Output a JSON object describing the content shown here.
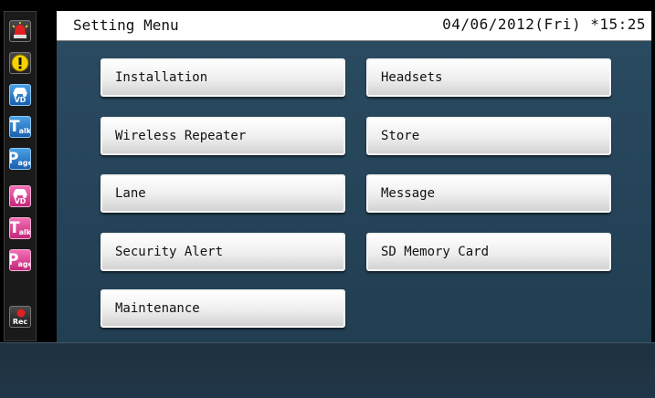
{
  "header": {
    "title": "Setting Menu",
    "datetime": "04/06/2012(Fri) *15:25"
  },
  "sidebar": {
    "icons": [
      {
        "name": "alarm-lamp-icon"
      },
      {
        "name": "warning-icon",
        "glyph": "!"
      },
      {
        "name": "vehicle-detector-icon",
        "label": "VD",
        "color": "blue"
      },
      {
        "name": "talk-icon",
        "big": "T",
        "small": "alk",
        "color": "blue"
      },
      {
        "name": "page-icon",
        "big": "P",
        "small": "age",
        "color": "blue"
      },
      {
        "name": "vehicle-detector-icon",
        "label": "VD",
        "color": "pink"
      },
      {
        "name": "talk-icon",
        "big": "T",
        "small": "alk",
        "color": "pink"
      },
      {
        "name": "page-icon",
        "big": "P",
        "small": "age",
        "color": "pink"
      },
      {
        "name": "record-icon",
        "label": "Rec"
      }
    ]
  },
  "menu": {
    "left": [
      {
        "label": "Installation"
      },
      {
        "label": "Wireless Repeater"
      },
      {
        "label": "Lane"
      },
      {
        "label": "Security Alert"
      },
      {
        "label": "Maintenance"
      }
    ],
    "right": [
      {
        "label": "Headsets"
      },
      {
        "label": "Store"
      },
      {
        "label": "Message"
      },
      {
        "label": "SD Memory Card"
      }
    ]
  },
  "colors": {
    "panel": "#264559",
    "blue_icon": "#2a78c8",
    "pink_icon": "#e0489a",
    "alarm_red": "#e02020",
    "warning_yellow": "#f6d300"
  }
}
